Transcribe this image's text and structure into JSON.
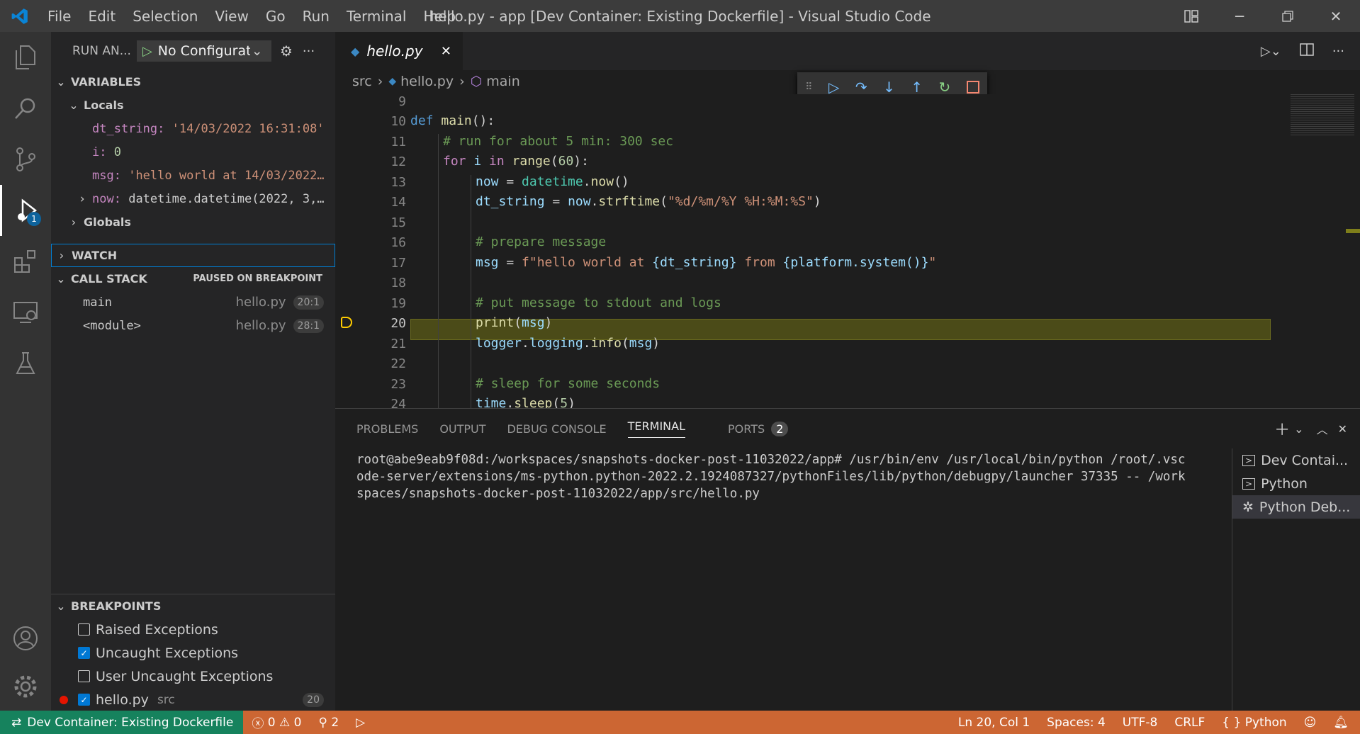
{
  "window": {
    "title": "hello.py - app [Dev Container: Existing Dockerfile] - Visual Studio Code",
    "menu": [
      "File",
      "Edit",
      "Selection",
      "View",
      "Go",
      "Run",
      "Terminal",
      "Help"
    ]
  },
  "activity": {
    "debug_badge": "1"
  },
  "sidebar": {
    "header": "RUN AN...",
    "config": "No Configurat",
    "variables": {
      "title": "VARIABLES",
      "locals_label": "Locals",
      "items": [
        {
          "name": "dt_string:",
          "value": "'14/03/2022 16:31:08'"
        },
        {
          "name": "i:",
          "value": "0"
        },
        {
          "name": "msg:",
          "value": "'hello world at 14/03/2022…"
        },
        {
          "name": "now:",
          "value": "datetime.datetime(2022, 3,…"
        }
      ],
      "globals_label": "Globals"
    },
    "watch": {
      "title": "WATCH"
    },
    "callstack": {
      "title": "CALL STACK",
      "status": "PAUSED ON BREAKPOINT",
      "frames": [
        {
          "name": "main",
          "file": "hello.py",
          "pos": "20:1"
        },
        {
          "name": "<module>",
          "file": "hello.py",
          "pos": "28:1"
        }
      ]
    },
    "breakpoints": {
      "title": "BREAKPOINTS",
      "items": [
        {
          "label": "Raised Exceptions",
          "checked": false
        },
        {
          "label": "Uncaught Exceptions",
          "checked": true
        },
        {
          "label": "User Uncaught Exceptions",
          "checked": false
        }
      ],
      "file": {
        "label": "hello.py",
        "dir": "src",
        "line": "20"
      }
    }
  },
  "editor": {
    "tab_label": "hello.py",
    "breadcrumb": [
      "src",
      "hello.py",
      "main"
    ],
    "lines": [
      "9",
      "10",
      "11",
      "12",
      "13",
      "14",
      "15",
      "16",
      "17",
      "18",
      "19",
      "20",
      "21",
      "22",
      "23",
      "24"
    ],
    "code": {
      "l10": [
        "def",
        "main",
        "():"
      ],
      "l11": "# run for about 5 min: 300 sec",
      "l12": [
        "for",
        "i",
        "in",
        "range",
        "(",
        "60",
        "):"
      ],
      "l13": [
        "now",
        " = ",
        "datetime",
        ".",
        "now",
        "()"
      ],
      "l14": [
        "dt_string",
        " = ",
        "now",
        ".",
        "strftime",
        "(",
        "\"%d/%m/%Y %H:%M:%S\"",
        ")"
      ],
      "l16": "# prepare message",
      "l17": [
        "msg",
        " = ",
        "f\"hello world at ",
        "{dt_string}",
        " from ",
        "{platform.system()}",
        "\""
      ],
      "l19": "# put message to stdout and logs",
      "l20": [
        "print",
        "(",
        "msg",
        ")"
      ],
      "l21": [
        "logger",
        ".",
        "logging",
        ".",
        "info",
        "(",
        "msg",
        ")"
      ],
      "l23": "# sleep for some seconds",
      "l24": [
        "time",
        ".",
        "sleep",
        "(",
        "5",
        ")"
      ]
    }
  },
  "panel": {
    "tabs": [
      "PROBLEMS",
      "OUTPUT",
      "DEBUG CONSOLE",
      "TERMINAL",
      "PORTS"
    ],
    "ports_count": "2",
    "terminal_text": "root@abe9eab9f08d:/workspaces/snapshots-docker-post-11032022/app#  /usr/bin/env /usr/local/bin/python /root/.vscode-server/extensions/ms-python.python-2022.2.1924087327/pythonFiles/lib/python/debugpy/launcher 37335 -- /workspaces/snapshots-docker-post-11032022/app/src/hello.py",
    "terminals": [
      "Dev Contai...",
      "Python",
      "Python Deb..."
    ]
  },
  "status": {
    "remote": "Dev Container: Existing Dockerfile",
    "errors": "0",
    "warnings": "0",
    "ports": "2",
    "position": "Ln 20, Col 1",
    "spaces": "Spaces: 4",
    "encoding": "UTF-8",
    "eol": "CRLF",
    "language": "Python"
  },
  "colors": {
    "statusbar": "#cc6633",
    "remote": "#16825d",
    "current_line": "#4b4b18"
  }
}
